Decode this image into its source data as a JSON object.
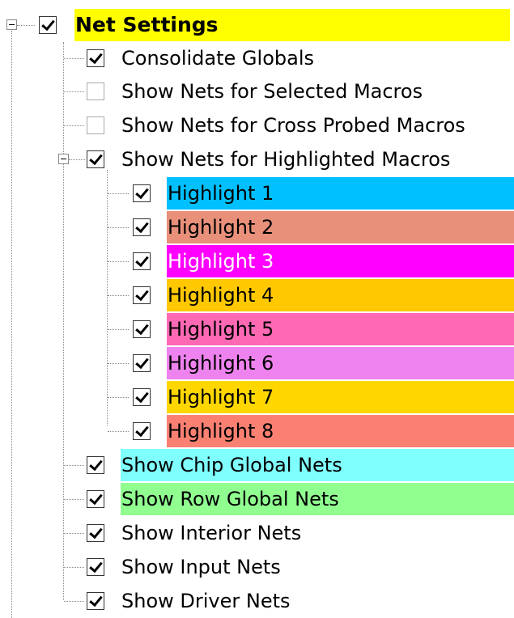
{
  "root": {
    "label": "Net Settings",
    "checked": true,
    "bg": "#ffff00"
  },
  "items": [
    {
      "label": "Consolidate Globals",
      "checked": true
    },
    {
      "label": "Show Nets for Selected Macros",
      "checked": false
    },
    {
      "label": "Show Nets for Cross Probed Macros",
      "checked": false
    },
    {
      "label": "Show Nets for Highlighted Macros",
      "checked": true
    }
  ],
  "highlights": [
    {
      "label": "Highlight 1",
      "checked": true,
      "bg": "#00c0ff",
      "fg": "#000000"
    },
    {
      "label": "Highlight 2",
      "checked": true,
      "bg": "#e8907a",
      "fg": "#000000"
    },
    {
      "label": "Highlight 3",
      "checked": true,
      "bg": "#ff00ff",
      "fg": "#ffffff"
    },
    {
      "label": "Highlight 4",
      "checked": true,
      "bg": "#ffc800",
      "fg": "#000000"
    },
    {
      "label": "Highlight 5",
      "checked": true,
      "bg": "#ff69b4",
      "fg": "#000000"
    },
    {
      "label": "Highlight 6",
      "checked": true,
      "bg": "#ee82ee",
      "fg": "#000000"
    },
    {
      "label": "Highlight 7",
      "checked": true,
      "bg": "#ffd700",
      "fg": "#000000"
    },
    {
      "label": "Highlight 8",
      "checked": true,
      "bg": "#fa8072",
      "fg": "#000000"
    }
  ],
  "bottom_items": [
    {
      "label": "Show Chip Global Nets",
      "checked": true,
      "bg": "#80ffff"
    },
    {
      "label": "Show Row Global Nets",
      "checked": true,
      "bg": "#90ff90"
    },
    {
      "label": "Show Interior Nets",
      "checked": true,
      "bg": ""
    },
    {
      "label": "Show Input Nets",
      "checked": true,
      "bg": ""
    },
    {
      "label": "Show Driver Nets",
      "checked": true,
      "bg": ""
    }
  ]
}
